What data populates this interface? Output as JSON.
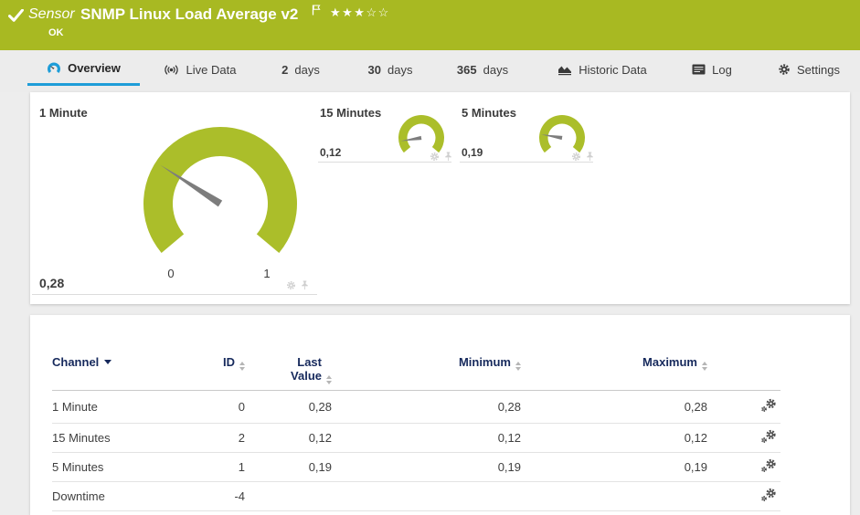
{
  "colors": {
    "header_bg": "#a8b922",
    "accent_blue": "#1e9dd8",
    "gauge_green": "#abbe2a",
    "table_header": "#16295c"
  },
  "header": {
    "kind": "Sensor",
    "title": "SNMP Linux Load Average v2",
    "status": "OK",
    "stars_filled": "★★★",
    "stars_empty": "☆☆",
    "status_icon": "check-icon",
    "flag_icon": "flag-icon"
  },
  "tabs": [
    {
      "label": "Overview",
      "icon": "gauge-icon",
      "active": true
    },
    {
      "label": "Live Data",
      "icon": "live-data-icon"
    },
    {
      "prefix": "2",
      "label": "days"
    },
    {
      "prefix": "30",
      "label": "days"
    },
    {
      "prefix": "365",
      "label": "days"
    },
    {
      "label": "Historic Data",
      "icon": "historic-data-icon"
    },
    {
      "label": "Log",
      "icon": "log-icon"
    },
    {
      "label": "Settings",
      "icon": "gear-icon"
    }
  ],
  "gauges": [
    {
      "name": "1 Minute",
      "value": 0.28,
      "display": "0,28",
      "min": 0,
      "max": 1,
      "min_label": "0",
      "max_label": "1"
    },
    {
      "name": "15 Minutes",
      "value": 0.12,
      "display": "0,12",
      "min": 0,
      "max": 1
    },
    {
      "name": "5 Minutes",
      "value": 0.19,
      "display": "0,19",
      "min": 0,
      "max": 1
    }
  ],
  "table": {
    "columns": [
      {
        "label": "Channel",
        "sort": "desc"
      },
      {
        "label": "ID",
        "sort": "both"
      },
      {
        "label": "Last Value",
        "sort": "both"
      },
      {
        "label": "Minimum",
        "sort": "both"
      },
      {
        "label": "Maximum",
        "sort": "both"
      }
    ],
    "rows": [
      {
        "channel": "1 Minute",
        "id": "0",
        "last_value": "0,28",
        "minimum": "0,28",
        "maximum": "0,28"
      },
      {
        "channel": "15 Minutes",
        "id": "2",
        "last_value": "0,12",
        "minimum": "0,12",
        "maximum": "0,12"
      },
      {
        "channel": "5 Minutes",
        "id": "1",
        "last_value": "0,19",
        "minimum": "0,19",
        "maximum": "0,19"
      },
      {
        "channel": "Downtime",
        "id": "-4",
        "last_value": "",
        "minimum": "",
        "maximum": ""
      }
    ]
  }
}
